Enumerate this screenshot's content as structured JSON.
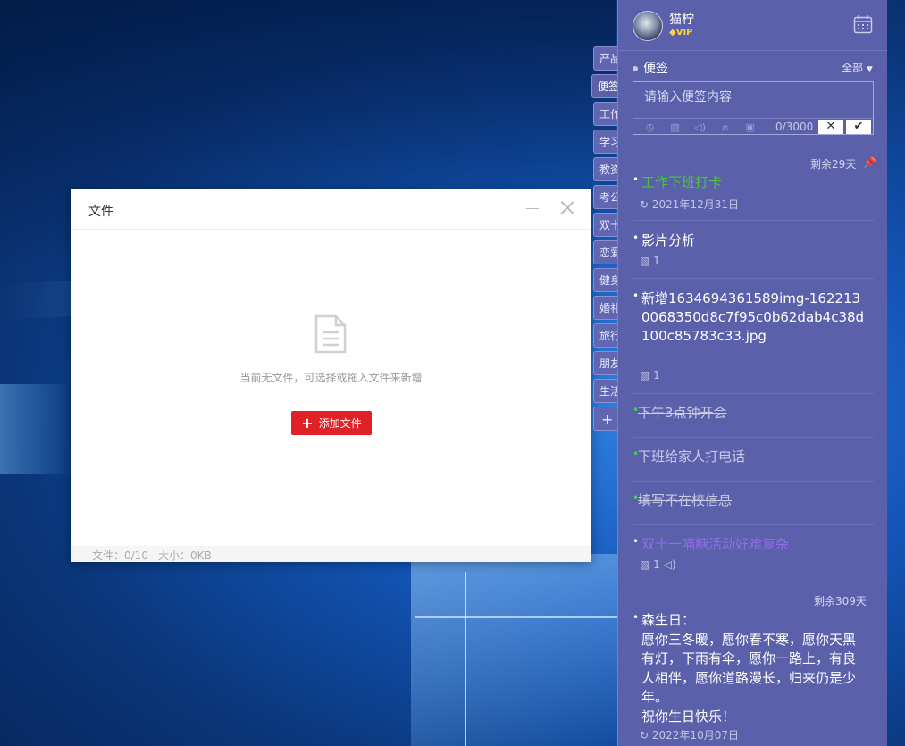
{
  "dialog": {
    "title": "文件",
    "empty_text": "当前无文件，可选择或拖入文件来新增",
    "add_button": "添加文件",
    "footer_files": "文件：0/10",
    "footer_size": "大小：0KB"
  },
  "tabs": [
    "产品",
    "便签",
    "工作",
    "学习",
    "教资",
    "考公",
    "双十",
    "恋爱",
    "健身",
    "婚礼",
    "旅行",
    "朋友",
    "生活"
  ],
  "tab_add": "+",
  "panel": {
    "user_name": "猫柠",
    "vip_label": "VIP",
    "section_title": "便签",
    "filter_label": "全部",
    "input_placeholder": "请输入便签内容",
    "counter": "0/3000",
    "cancel_label": "✕",
    "confirm_label": "✔",
    "remain_1": "剩余29天",
    "remain_2": "剩余309天"
  },
  "notes": [
    {
      "title": "工作下班打卡",
      "meta": "2021年12月31日"
    },
    {
      "title": "影片分析",
      "meta": "1"
    },
    {
      "title": "新增1634694361589img-1622130068350d8c7f95c0b62dab4c38d100c85783c33.jpg",
      "meta": "1"
    },
    {
      "title": "下午3点钟开会"
    },
    {
      "title": "下班给家人打电话"
    },
    {
      "title": "填写不在校信息"
    },
    {
      "title": "双十一喵糖活动好难复杂",
      "meta": "1"
    },
    {
      "title": "森生日：\n愿你三冬暖，愿你春不寒，愿你天黑有灯，下雨有伞，愿你一路上，有良人相伴，愿你道路漫长，归来仍是少年。\n祝你生日快乐！",
      "meta": "2022年10月07日"
    }
  ]
}
